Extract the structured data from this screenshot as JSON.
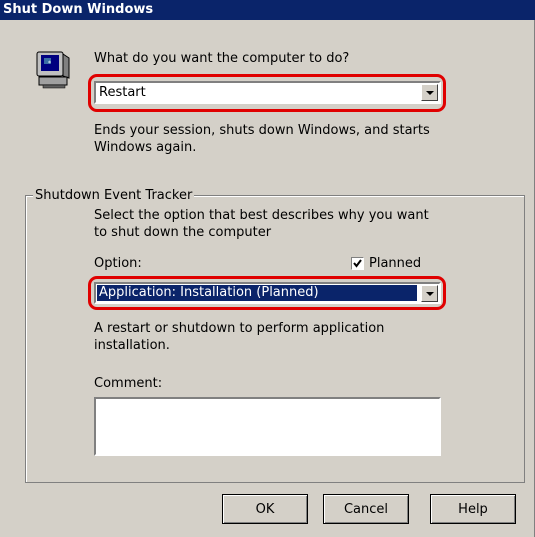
{
  "window": {
    "title": "Shut Down Windows"
  },
  "main": {
    "question": "What do you want the computer to do?",
    "action_select": {
      "value": "Restart"
    },
    "action_description": "Ends your session, shuts down Windows, and starts Windows again."
  },
  "tracker": {
    "group_label": "Shutdown Event Tracker",
    "instruction": "Select the option that best describes why you want to shut down the computer",
    "option_label": "Option:",
    "planned_label": "Planned",
    "planned_checked": true,
    "option_select": {
      "value": "Application: Installation (Planned)"
    },
    "option_description": "A restart or shutdown to perform application installation.",
    "comment_label": "Comment:",
    "comment_value": ""
  },
  "buttons": {
    "ok": "OK",
    "cancel": "Cancel",
    "help": "Help"
  },
  "colors": {
    "title_bar": "#0a246a",
    "face": "#d4d0c8",
    "selection": "#0a246a",
    "highlight_outline": "#e00000"
  }
}
